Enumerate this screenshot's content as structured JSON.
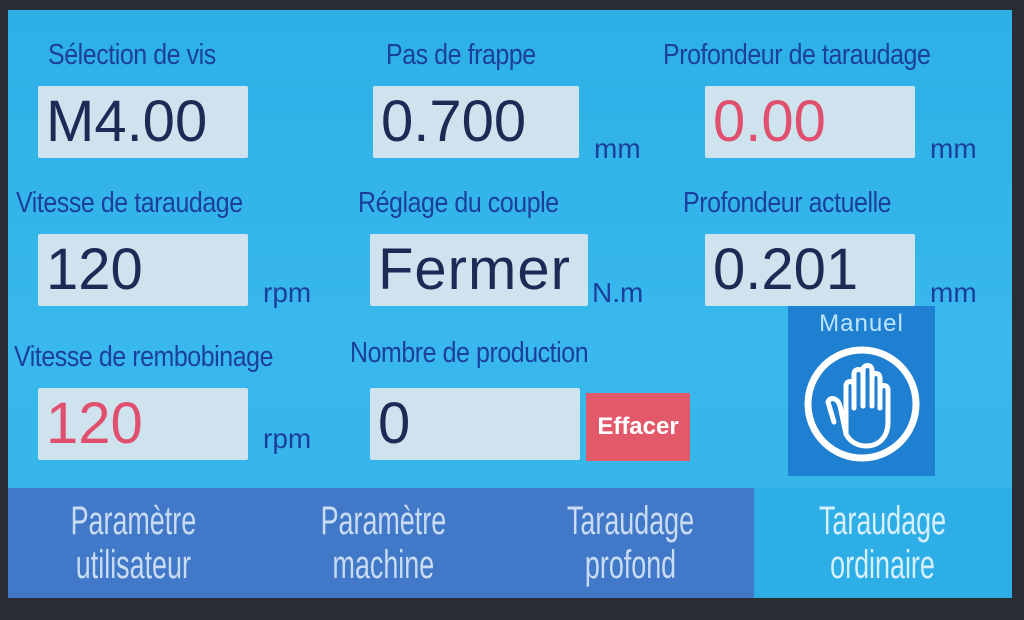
{
  "fields": {
    "screw_selection": {
      "label": "Sélection de vis",
      "value": "M4.00",
      "unit": ""
    },
    "pitch": {
      "label": "Pas de frappe",
      "value": "0.700",
      "unit": "mm"
    },
    "tapping_depth": {
      "label": "Profondeur de taraudage",
      "value": "0.00",
      "unit": "mm"
    },
    "tapping_speed": {
      "label": "Vitesse de taraudage",
      "value": "120",
      "unit": "rpm"
    },
    "torque_setting": {
      "label": "Réglage du couple",
      "value": "Fermer",
      "unit": "N.m"
    },
    "current_depth": {
      "label": "Profondeur actuelle",
      "value": "0.201",
      "unit": "mm"
    },
    "rewind_speed": {
      "label": "Vitesse de rembobinage",
      "value": "120",
      "unit": "rpm"
    },
    "production_count": {
      "label": "Nombre de production",
      "value": "0"
    }
  },
  "clear_button": {
    "label": "Effacer"
  },
  "manual_button": {
    "label": "Manuel",
    "icon": "hand-stop-icon"
  },
  "tabs": [
    {
      "line1": "Paramètre",
      "line2": "utilisateur"
    },
    {
      "line1": "Paramètre",
      "line2": "machine"
    },
    {
      "line1": "Taraudage",
      "line2": "profond"
    },
    {
      "line1": "Taraudage",
      "line2": "ordinaire"
    }
  ],
  "colors": {
    "screen_bg": "#33b3e8",
    "label_text": "#1c3f9e",
    "value_text": "#1e2a55",
    "alert_value_text": "#e0506e",
    "clear_button_bg": "#e25a6a",
    "manual_button_bg": "#1f7fd0",
    "tab_bar_bg": "#4278c8",
    "active_tab_bg": "#2eaee6"
  }
}
